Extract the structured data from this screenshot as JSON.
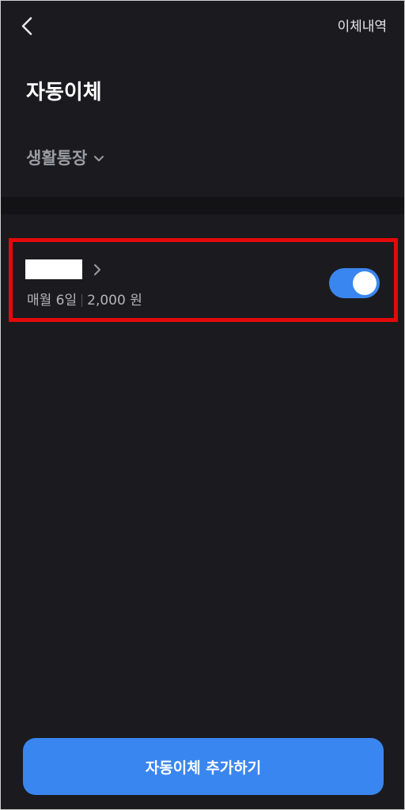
{
  "header": {
    "back_icon": "chevron-left-icon",
    "history_label": "이체내역"
  },
  "page": {
    "title": "자동이체"
  },
  "account": {
    "name": "생활통장",
    "dropdown_icon": "chevron-down-icon"
  },
  "transfers": [
    {
      "recipient": "",
      "schedule": "매월 6일",
      "amount": "2,000 원",
      "enabled": true
    }
  ],
  "footer": {
    "add_label": "자동이체 추가하기"
  },
  "colors": {
    "background": "#1b1b1f",
    "accent": "#3a86f0",
    "highlight": "#e20a0a"
  }
}
